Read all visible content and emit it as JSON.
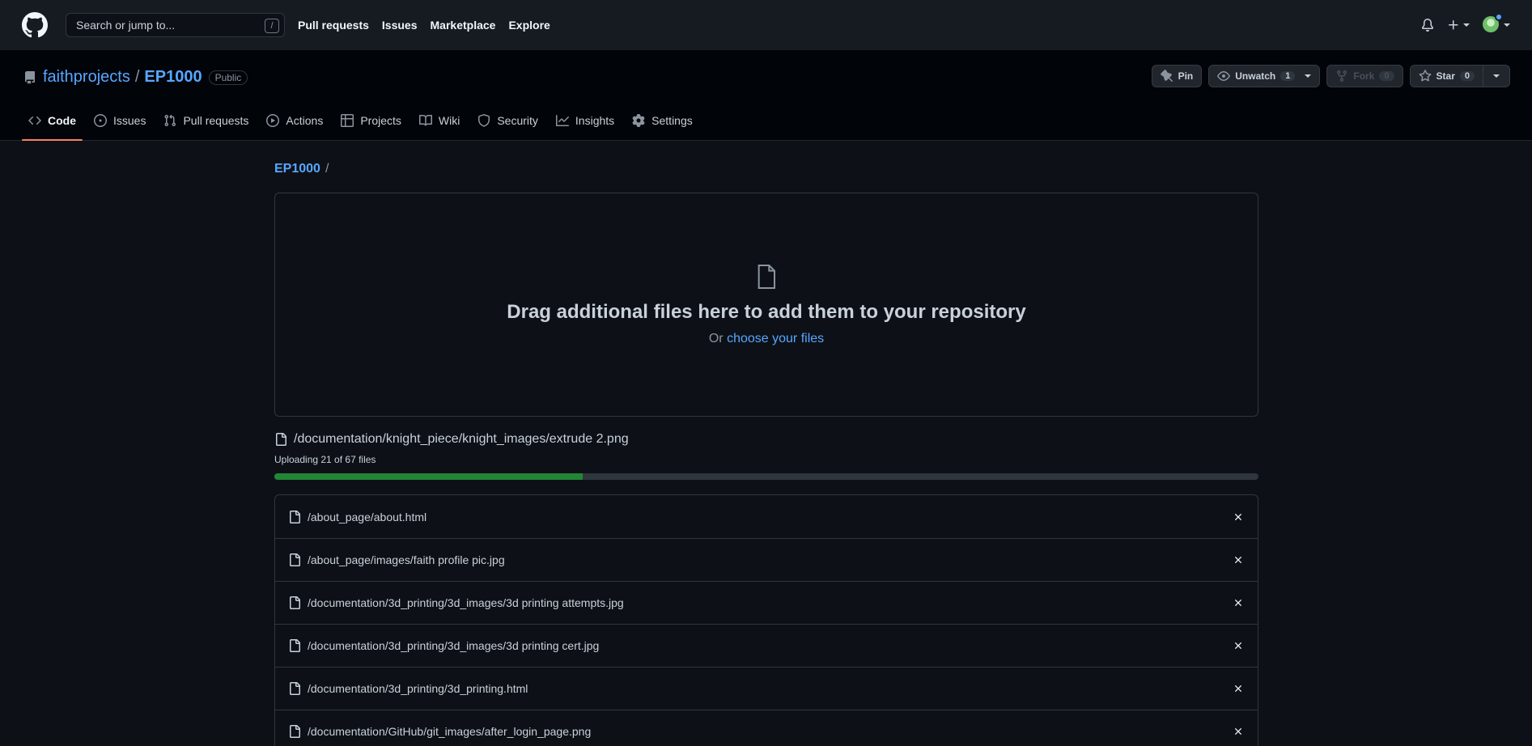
{
  "header": {
    "search_placeholder": "Search or jump to...",
    "search_shortcut": "/",
    "nav": [
      {
        "label": "Pull requests"
      },
      {
        "label": "Issues"
      },
      {
        "label": "Marketplace"
      },
      {
        "label": "Explore"
      }
    ],
    "icons": [
      "github-logo-icon",
      "bell-icon",
      "plus-icon",
      "avatar"
    ]
  },
  "repo": {
    "owner": "faithprojects",
    "separator": "/",
    "name": "EP1000",
    "visibility": "Public",
    "pin_label": "Pin",
    "unwatch_label": "Unwatch",
    "watch_count": "1",
    "fork_label": "Fork",
    "fork_count": "0",
    "star_label": "Star",
    "star_count": "0"
  },
  "repo_nav": [
    {
      "label": "Code",
      "icon": "code-icon",
      "selected": true
    },
    {
      "label": "Issues",
      "icon": "issue-icon"
    },
    {
      "label": "Pull requests",
      "icon": "pull-request-icon"
    },
    {
      "label": "Actions",
      "icon": "play-icon"
    },
    {
      "label": "Projects",
      "icon": "table-icon"
    },
    {
      "label": "Wiki",
      "icon": "book-icon"
    },
    {
      "label": "Security",
      "icon": "shield-icon"
    },
    {
      "label": "Insights",
      "icon": "graph-icon"
    },
    {
      "label": "Settings",
      "icon": "gear-icon"
    }
  ],
  "breadcrumb": {
    "repo": "EP1000",
    "sep": "/"
  },
  "dropzone": {
    "heading": "Drag additional files here to add them to your repository",
    "or_text": "Or",
    "choose_link": "choose your files"
  },
  "upload": {
    "current_file": "/documentation/knight_piece/knight_images/extrude 2.png",
    "status": "Uploading 21 of 67 files",
    "uploaded": 21,
    "total": 67
  },
  "files": [
    "/about_page/about.html",
    "/about_page/images/faith profile pic.jpg",
    "/documentation/3d_printing/3d_images/3d printing attempts.jpg",
    "/documentation/3d_printing/3d_images/3d printing cert.jpg",
    "/documentation/3d_printing/3d_printing.html",
    "/documentation/GitHub/git_images/after_login_page.png"
  ],
  "colors": {
    "background": "#0d1117",
    "header_bg": "#161b22",
    "link": "#58a6ff",
    "progress": "#238636",
    "tab_underline": "#f78166"
  }
}
